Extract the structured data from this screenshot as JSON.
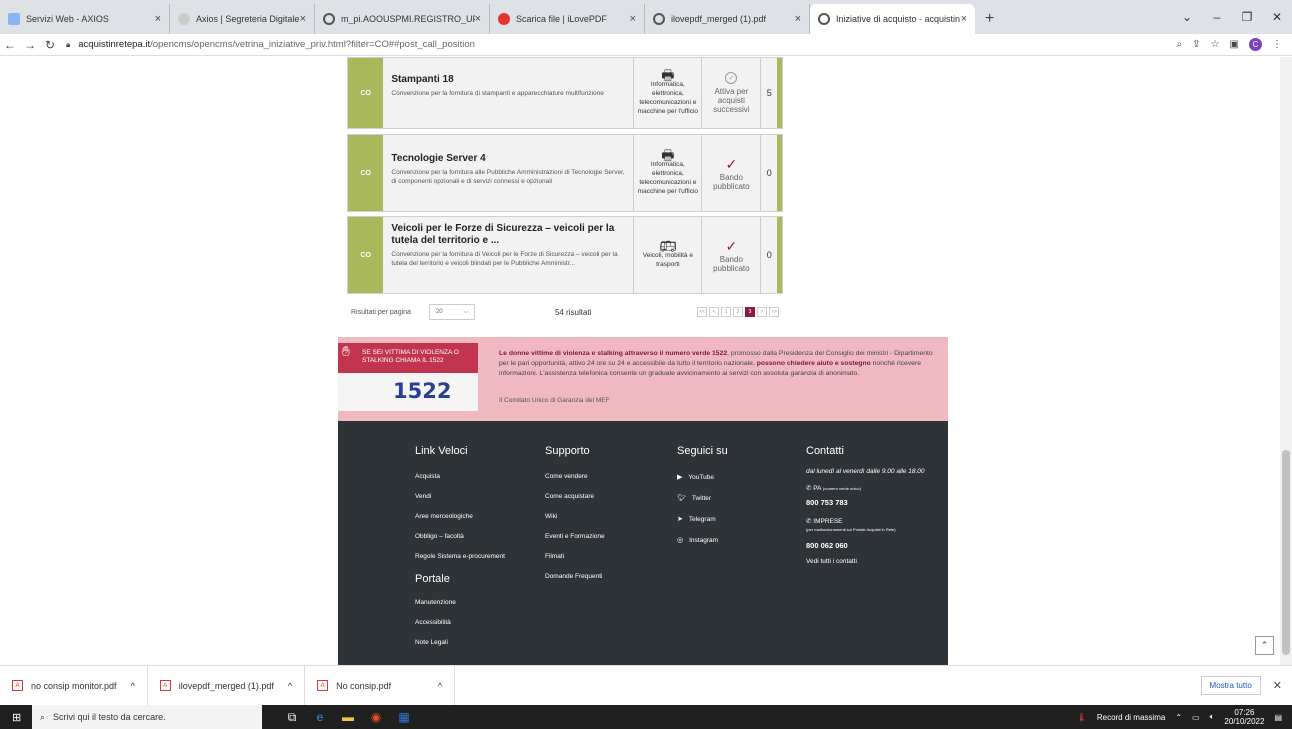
{
  "tabs": [
    {
      "label": "Servizi Web - AXIOS",
      "color": "#8ab4f8"
    },
    {
      "label": "Axios | Segreteria Digitale",
      "color": "#bbb"
    },
    {
      "label": "m_pi.AOOUSPMI.REGISTRO_UFFI",
      "color": "#555"
    },
    {
      "label": "Scarica file | iLovePDF",
      "color": "#e5322d"
    },
    {
      "label": "ilovepdf_merged (1).pdf",
      "color": "#555"
    },
    {
      "label": "Iniziative di acquisto - acquistin",
      "color": "#555"
    }
  ],
  "address": {
    "host": "acquistinretepa.it",
    "path": "/opencms/opencms/vetrina_iniziative_priv.html?filter=CO##post_call_position"
  },
  "cards": [
    {
      "code": "CO",
      "title": "Stampanti 18",
      "desc": "Convenzione per la fornitura di stampanti e apparecchiature multifunzione",
      "cat": "Informatica, elettronica, telecomunicazioni e macchine per l'ufficio",
      "status": "Attiva per acquisti successivi",
      "count": "5"
    },
    {
      "code": "CO",
      "title": "Tecnologie Server 4",
      "desc": "Convenzione per la fornitura alle Pubbliche Amministrazioni di Tecnologie Server, di componenti opzionali e di servizi connessi e opzionali",
      "cat": "Informatica, elettronica, telecomunicazioni e macchine per l'ufficio",
      "status": "Bando pubblicato",
      "count": "0"
    },
    {
      "code": "CO",
      "title": "Veicoli per le Forze di Sicurezza – veicoli per la tutela del territorio e ...",
      "desc": "Convenzione per la fornitura di Veicoli per le Forze di Sicurezza – veicoli per la tutela del territorio e veicoli blindati per le Pubbliche Amministr...",
      "cat": "Veicoli, mobilità e trasporti",
      "status": "Bando pubblicato",
      "count": "0"
    }
  ],
  "pager": {
    "label": "Risultati per pagina",
    "per_page": "20",
    "results": "54 risultati",
    "pages": [
      "<<",
      "<",
      "1",
      "2",
      "3",
      ">",
      ">>"
    ]
  },
  "banner": {
    "img_text": "SE SEI VITTIMA DI VIOLENZA O STALKING CHIAMA IL 1522",
    "img_number": "1522",
    "text_bold1": "Le donne vittime di violenza e stalking attraverso il numero verde 1522",
    "text1": ", promosso dalla Presidenza del Consiglio dei ministri - Dipartimento per le pari opportunità, attivo 24 ore su 24 e accessibile da tutto il territorio nazionale, ",
    "text_bold2": "possono chiedere aiuto e sostegno",
    "text2": " nonché ricevere informazioni. L'assistenza telefonica consente un graduale avvicinamento ai servizi con assoluta garanzia di anonimato.",
    "sign": "Il Comitato Unico di Garanzia del MEF"
  },
  "footer": {
    "link_veloci": {
      "title": "Link Veloci",
      "items": [
        "Acquista",
        "Vendi",
        "Aree merceologiche",
        "Obbligo – facoltà",
        "Regole Sistema e-procurement"
      ]
    },
    "portale": {
      "title": "Portale",
      "items": [
        "Manutenzione",
        "Accessibilità",
        "Note Legali"
      ]
    },
    "supporto": {
      "title": "Supporto",
      "items": [
        "Come vendere",
        "Come acquistare",
        "Wiki",
        "Eventi e Formazione",
        "Filmati",
        "Domande Frequenti"
      ]
    },
    "seguici": {
      "title": "Seguici su",
      "items": [
        "YouTube",
        "Twitter",
        "Telegram",
        "Instagram"
      ]
    },
    "contatti": {
      "title": "Contatti",
      "hours": "dal lunedì al venerdì dalle 9.00 alle 18.00",
      "pa_label": "PA",
      "pa_note": "(numero verde unico)",
      "pa_number": "800 753 783",
      "imp_label": "IMPRESE",
      "imp_note": "(per malfunzionamenti sul Portale Acquisti in Rete)",
      "imp_number": "800 062 060",
      "all": "Vedi tutti i contatti"
    }
  },
  "downloads": [
    "no consip monitor.pdf",
    "ilovepdf_merged (1).pdf",
    "No consip.pdf"
  ],
  "showall": "Mostra tutto",
  "taskbar": {
    "search": "Scrivi qui il testo da cercare.",
    "tray_app": "Record di massima",
    "time": "07:26",
    "date": "20/10/2022"
  }
}
